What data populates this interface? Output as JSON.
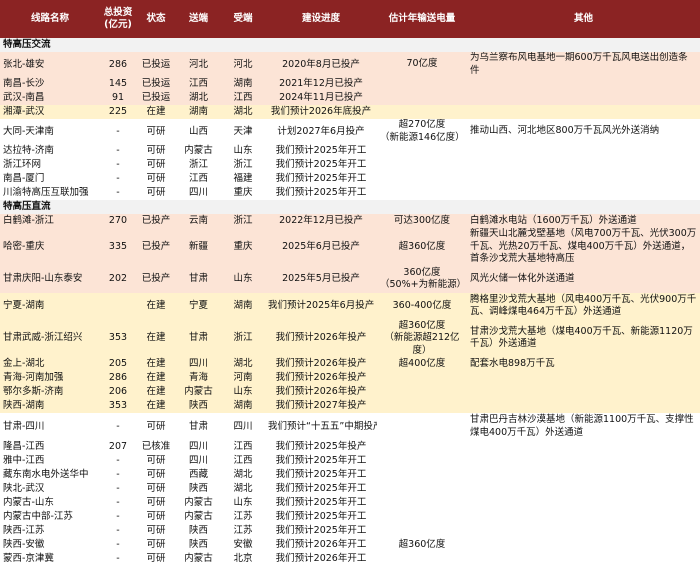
{
  "headers": [
    "线路名称",
    "总投资\n(亿元)",
    "状态",
    "送端",
    "受端",
    "建设进度",
    "估计年输送电量",
    "其他"
  ],
  "colors": {
    "header_bg": "#8B2323",
    "section_bg": "#F2F2F2",
    "operating_bg": "#FCE4D6",
    "construction_bg": "#FFF2CC"
  },
  "sections": [
    {
      "title": "特高压交流",
      "rows": [
        {
          "name": "张北-雄安",
          "invest": "286",
          "status": "已投运",
          "send": "河北",
          "recv": "河北",
          "progress": "2020年8月已投产",
          "volume": "70亿度",
          "other": "为乌兰察布风电基地一期600万千瓦风电送出创造条件",
          "tone": "pink"
        },
        {
          "name": "南昌-长沙",
          "invest": "145",
          "status": "已投运",
          "send": "江西",
          "recv": "湖南",
          "progress": "2021年12月已投产",
          "volume": "",
          "other": "",
          "tone": "pink"
        },
        {
          "name": "武汉-南昌",
          "invest": "91",
          "status": "已投运",
          "send": "湖北",
          "recv": "江西",
          "progress": "2024年11月已投产",
          "volume": "",
          "other": "",
          "tone": "pink"
        },
        {
          "name": "湘潭-武汉",
          "invest": "225",
          "status": "在建",
          "send": "湖南",
          "recv": "湖北",
          "progress": "我们预计2026年底投产",
          "volume": "",
          "other": "",
          "tone": "yellow"
        },
        {
          "name": "大同-天津南",
          "invest": "-",
          "status": "可研",
          "send": "山西",
          "recv": "天津",
          "progress": "计划2027年6月投产",
          "volume": "超270亿度\n（新能源146亿度）",
          "other": "推动山西、河北地区800万千瓦风光外送消纳",
          "tone": "",
          "h": "h2"
        },
        {
          "name": "达拉特-济南",
          "invest": "-",
          "status": "可研",
          "send": "内蒙古",
          "recv": "山东",
          "progress": "我们预计2025年开工",
          "volume": "",
          "other": "",
          "tone": ""
        },
        {
          "name": "浙江环网",
          "invest": "-",
          "status": "可研",
          "send": "浙江",
          "recv": "浙江",
          "progress": "我们预计2025年开工",
          "volume": "",
          "other": "",
          "tone": ""
        },
        {
          "name": "南昌-厦门",
          "invest": "-",
          "status": "可研",
          "send": "江西",
          "recv": "福建",
          "progress": "我们预计2025年开工",
          "volume": "",
          "other": "",
          "tone": ""
        },
        {
          "name": "川渝特高压互联加强",
          "invest": "-",
          "status": "可研",
          "send": "四川",
          "recv": "重庆",
          "progress": "我们预计2025年开工",
          "volume": "",
          "other": "",
          "tone": ""
        }
      ]
    },
    {
      "title": "特高压直流",
      "rows": [
        {
          "name": "白鹤滩-浙江",
          "invest": "270",
          "status": "已投产",
          "send": "云南",
          "recv": "浙江",
          "progress": "2022年12月已投产",
          "volume": "可达300亿度",
          "other": "白鹤滩水电站（1600万千瓦）外送通道",
          "tone": "pink"
        },
        {
          "name": "哈密-重庆",
          "invest": "335",
          "status": "已投产",
          "send": "新疆",
          "recv": "重庆",
          "progress": "2025年6月已投产",
          "volume": "超360亿度",
          "other": "新疆天山北麓戈壁基地（风电700万千瓦、光伏300万千瓦、光热20万千瓦、煤电400万千瓦）外送通道，首条沙戈荒大基地特高压",
          "tone": "pink",
          "h": "h3"
        },
        {
          "name": "甘肃庆阳-山东泰安",
          "invest": "202",
          "status": "已投产",
          "send": "甘肃",
          "recv": "山东",
          "progress": "2025年5月已投产",
          "volume": "360亿度\n（50%+为新能源）",
          "other": "风光火储一体化外送通道",
          "tone": "pink",
          "h": "h3"
        },
        {
          "name": "宁夏-湖南",
          "invest": "",
          "status": "在建",
          "send": "宁夏",
          "recv": "湖南",
          "progress": "我们预计2025年6月投产",
          "volume": "360-400亿度",
          "other": "腾格里沙戈荒大基地（风电400万千瓦、光伏900万千瓦、调峰煤电464万千瓦）外送通道",
          "tone": "yellow",
          "h": "h3"
        },
        {
          "name": "甘肃武威-浙江绍兴",
          "invest": "353",
          "status": "在建",
          "send": "甘肃",
          "recv": "浙江",
          "progress": "我们预计2026年投产",
          "volume": "超360亿度\n（新能源超212亿度）",
          "other": "甘肃沙戈荒大基地（煤电400万千瓦、新能源1120万千瓦）外送通道",
          "tone": "yellow",
          "h": "h3"
        },
        {
          "name": "金上-湖北",
          "invest": "205",
          "status": "在建",
          "send": "四川",
          "recv": "湖北",
          "progress": "我们预计2026年投产",
          "volume": "超400亿度",
          "other": "配套水电898万千瓦",
          "tone": "yellow"
        },
        {
          "name": "青海-河南加强",
          "invest": "286",
          "status": "在建",
          "send": "青海",
          "recv": "河南",
          "progress": "我们预计2026年投产",
          "volume": "",
          "other": "",
          "tone": "yellow"
        },
        {
          "name": "鄂尔多斯-济南",
          "invest": "206",
          "status": "在建",
          "send": "内蒙古",
          "recv": "山东",
          "progress": "我们预计2026年投产",
          "volume": "",
          "other": "",
          "tone": "yellow"
        },
        {
          "name": "陕西-湖南",
          "invest": "353",
          "status": "在建",
          "send": "陕西",
          "recv": "湖南",
          "progress": "我们预计2027年投产",
          "volume": "",
          "other": "",
          "tone": "yellow"
        },
        {
          "name": "甘肃-四川",
          "invest": "-",
          "status": "可研",
          "send": "甘肃",
          "recv": "四川",
          "progress": "我们预计“十五五”中期投产",
          "volume": "",
          "other": "甘肃巴丹吉林沙漠基地（新能源1100万千瓦、支撑性煤电400万千瓦）外送通道",
          "tone": "",
          "h": "h3"
        },
        {
          "name": "隆昌-江西",
          "invest": "207",
          "status": "已核准",
          "send": "四川",
          "recv": "江西",
          "progress": "我们预计2025年投产",
          "volume": "",
          "other": "",
          "tone": ""
        },
        {
          "name": "雅中-江西",
          "invest": "-",
          "status": "可研",
          "send": "四川",
          "recv": "江西",
          "progress": "我们预计2025年开工",
          "volume": "",
          "other": "",
          "tone": ""
        },
        {
          "name": "藏东南水电外送华中",
          "invest": "-",
          "status": "可研",
          "send": "西藏",
          "recv": "湖北",
          "progress": "我们预计2025年开工",
          "volume": "",
          "other": "",
          "tone": ""
        },
        {
          "name": "陕北-武汉",
          "invest": "-",
          "status": "可研",
          "send": "陕西",
          "recv": "湖北",
          "progress": "我们预计2025年开工",
          "volume": "",
          "other": "",
          "tone": ""
        },
        {
          "name": "内蒙古-山东",
          "invest": "-",
          "status": "可研",
          "send": "内蒙古",
          "recv": "山东",
          "progress": "我们预计2025年开工",
          "volume": "",
          "other": "",
          "tone": ""
        },
        {
          "name": "内蒙古中部-江苏",
          "invest": "-",
          "status": "可研",
          "send": "内蒙古",
          "recv": "江苏",
          "progress": "我们预计2025年开工",
          "volume": "",
          "other": "",
          "tone": ""
        },
        {
          "name": "陕西-江苏",
          "invest": "-",
          "status": "可研",
          "send": "陕西",
          "recv": "江苏",
          "progress": "我们预计2025年开工",
          "volume": "",
          "other": "",
          "tone": ""
        },
        {
          "name": "陕西-安徽",
          "invest": "-",
          "status": "可研",
          "send": "陕西",
          "recv": "安徽",
          "progress": "我们预计2026年开工",
          "volume": "超360亿度",
          "other": "",
          "tone": ""
        },
        {
          "name": "蒙西-京津冀",
          "invest": "-",
          "status": "可研",
          "send": "内蒙古",
          "recv": "北京",
          "progress": "我们预计2026年开工",
          "volume": "",
          "other": "",
          "tone": ""
        }
      ]
    }
  ]
}
